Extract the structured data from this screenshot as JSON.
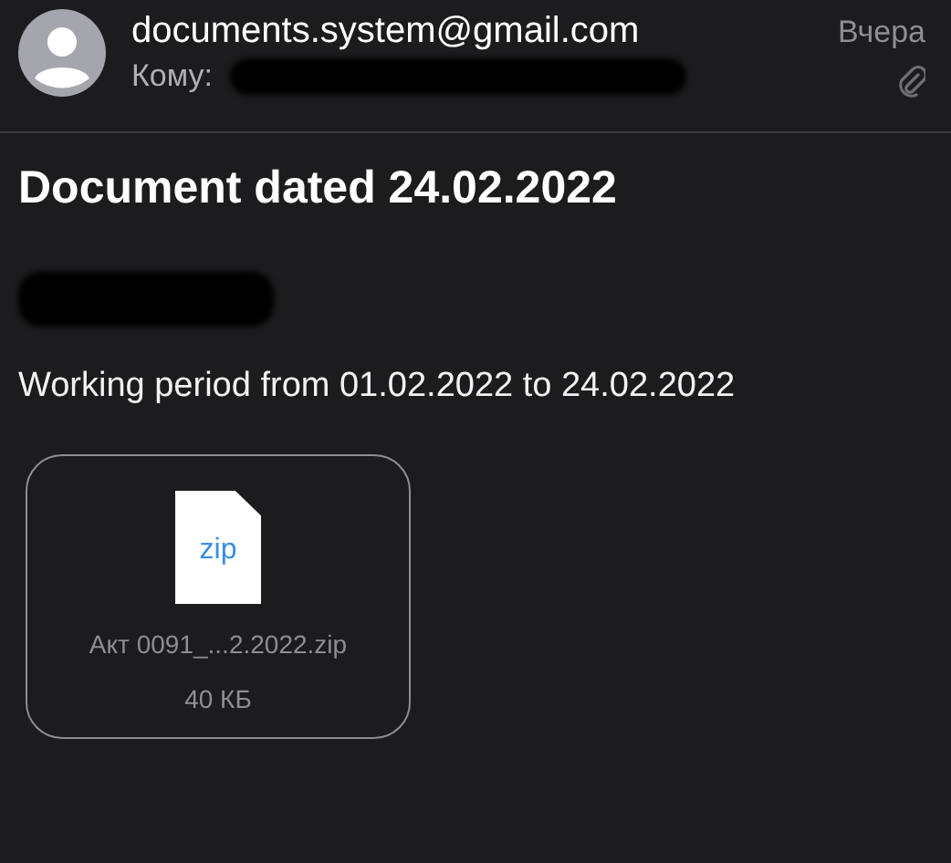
{
  "header": {
    "sender": "documents.system@gmail.com",
    "to_label": "Кому:",
    "date": "Вчера",
    "has_attachment": true
  },
  "subject": "Document dated 24.02.2022",
  "body": "Working period from 01.02.2022 to 24.02.2022",
  "attachment": {
    "type_label": "zip",
    "filename": "Акт 0091_...2.2022.zip",
    "size": "40 КБ"
  }
}
